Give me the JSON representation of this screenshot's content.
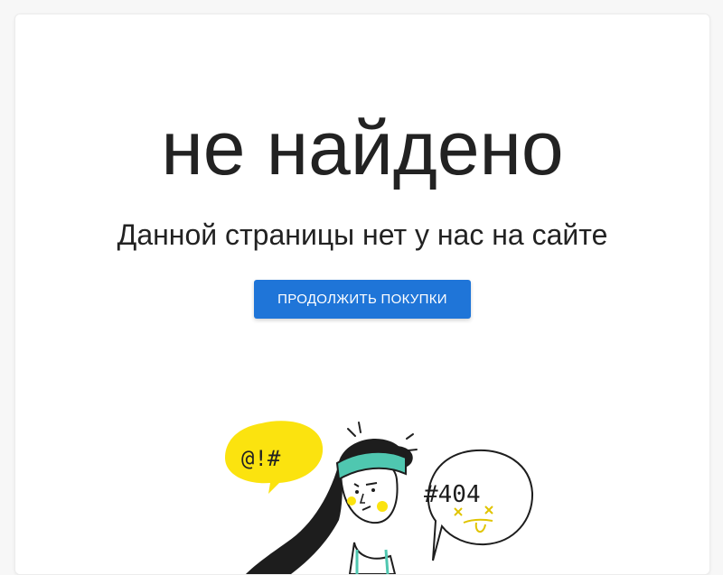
{
  "page": {
    "title": "не найдено",
    "subtitle": "Данной страницы нет у нас на сайте",
    "continue_button_label": "ПРОДОЛЖИТЬ ПОКУПКИ"
  },
  "illustration": {
    "speech_bubble_left_text": "@!#",
    "speech_bubble_right_text": "#404",
    "icon": "confused-person-illustration"
  },
  "colors": {
    "accent": "#1f75d8",
    "bubble_yellow": "#fbe30f",
    "headband_teal": "#4fc7b0",
    "text": "#222222"
  }
}
